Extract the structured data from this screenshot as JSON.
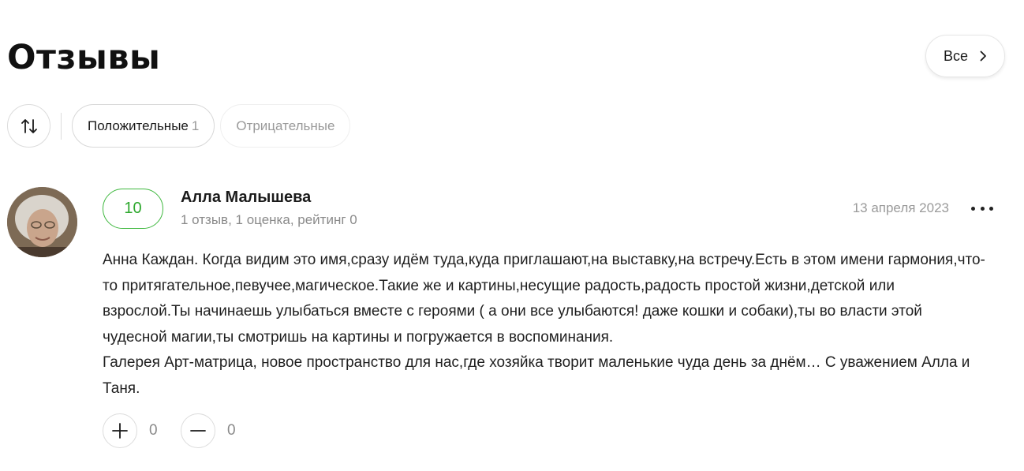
{
  "header": {
    "title": "Отзывы",
    "all_label": "Все"
  },
  "filters": {
    "positive_label": "Положительные",
    "positive_count": "1",
    "negative_label": "Отрицательные"
  },
  "review": {
    "rating": "10",
    "author_name": "Алла Малышева",
    "author_meta": "1 отзыв, 1 оценка, рейтинг 0",
    "date": "13 апреля 2023",
    "text_p1": "Анна Каждан. Когда видим это имя,сразу идём туда,куда приглашают,на выставку,на встречу.Есть в этом имени гармония,что-то притягательное,певучее,магическое.Такие же и картины,несущие радость,радость простой жизни,детской или взрослой.Ты начинаешь улыбаться вместе с героями ( а они все улыбаются! даже кошки и собаки),ты во власти этой чудесной магии,ты смотришь на картины и погружается в воспоминания.",
    "text_p2": "Галерея Арт-матрица, новое пространство для нас,где хозяйка творит маленькие чуда день за днём…   С уважением Алла и Таня.",
    "likes": "0",
    "dislikes": "0"
  },
  "colors": {
    "rating_accent": "#3fb83f",
    "muted_text": "#9a9a9a",
    "border": "#dcdcdc"
  },
  "icons": {
    "all_button": "chevron-right-icon",
    "sort": "sort-arrows-icon",
    "like": "plus-icon",
    "dislike": "minus-icon",
    "more": "more-dots-icon"
  }
}
